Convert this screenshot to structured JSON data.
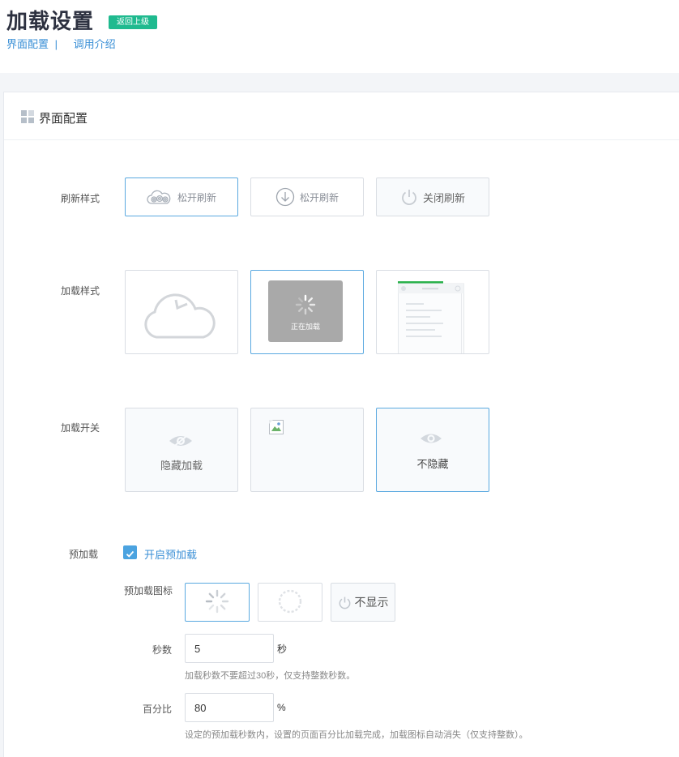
{
  "header": {
    "title": "加载设置",
    "back_label": "返回上级",
    "links": [
      "界面配置",
      "调用介绍"
    ],
    "separator": "|"
  },
  "panel": {
    "title": "界面配置"
  },
  "refresh_style": {
    "label": "刷新样式",
    "options": [
      {
        "label": "松开刷新",
        "icon": "cloud-swirl-icon",
        "selected": true
      },
      {
        "label": "松开刷新",
        "icon": "arrow-down-circle-icon",
        "selected": false
      },
      {
        "label": "关闭刷新",
        "icon": "power-icon",
        "selected": false
      }
    ]
  },
  "load_style": {
    "label": "加载样式",
    "options": [
      {
        "icon": "cloud-clock-icon",
        "selected": false
      },
      {
        "text": "正在加载",
        "icon": "spinner-icon",
        "selected": true
      },
      {
        "icon": "page-preview-icon",
        "selected": false
      }
    ]
  },
  "load_switch": {
    "label": "加载开关",
    "options": [
      {
        "label": "隐藏加载",
        "icon": "eye-slash-icon",
        "selected": false
      },
      {
        "icon": "broken-image-icon",
        "selected": false
      },
      {
        "label": "不隐藏",
        "icon": "eye-icon",
        "selected": true
      }
    ]
  },
  "preload": {
    "label": "预加载",
    "checkbox_label": "开启预加载",
    "checked": true,
    "icon_label": "预加载图标",
    "icons": [
      {
        "icon": "spinner-icon",
        "selected": true
      },
      {
        "icon": "dotted-ring-icon",
        "selected": false
      },
      {
        "label": "不显示",
        "icon": "power-icon",
        "selected": false
      }
    ],
    "seconds_label": "秒数",
    "seconds_value": "5",
    "seconds_unit": "秒",
    "seconds_hint": "加载秒数不要超过30秒，仅支持整数秒数。",
    "percent_label": "百分比",
    "percent_value": "80",
    "percent_unit": "%",
    "percent_hint": "设定的预加载秒数内，设置的页面百分比加载完成，加载图标自动消失（仅支持整数）。"
  },
  "colors": {
    "accent": "#4ba3e0",
    "badge": "#1fba8f",
    "link": "#3a8fd6"
  }
}
